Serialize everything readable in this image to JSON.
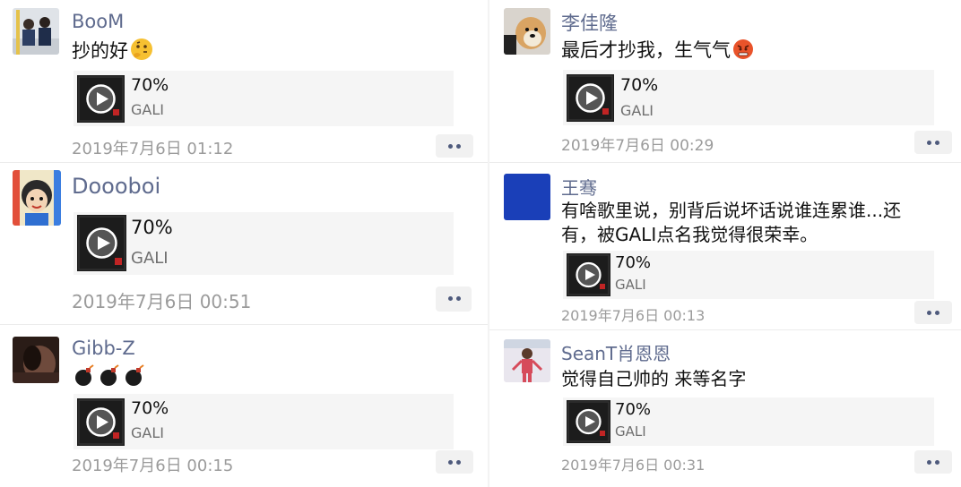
{
  "posts": [
    {
      "username": "BooM",
      "comment": "抄的好",
      "comment_emoji": "thinking-face",
      "music": {
        "title": "70%",
        "artist": "GALI"
      },
      "timestamp": "2019年7月6日 01:12"
    },
    {
      "username": "Doooboi",
      "comment": "",
      "music": {
        "title": "70%",
        "artist": "GALI"
      },
      "timestamp": "2019年7月6日 00:51"
    },
    {
      "username": "Gibb-Z",
      "comment": "",
      "comment_emoji": "bomb x3",
      "music": {
        "title": "70%",
        "artist": "GALI"
      },
      "timestamp": "2019年7月6日 00:15"
    },
    {
      "username": "李佳隆",
      "comment": "最后才抄我，生气气",
      "comment_emoji": "angry-face",
      "music": {
        "title": "70%",
        "artist": "GALI"
      },
      "timestamp": "2019年7月6日 00:29"
    },
    {
      "username": "王骞",
      "comment_line1": "有啥歌里说，别背后说坏话说谁连累谁...还",
      "comment_line2": "有，被GALI点名我觉得很荣幸。",
      "music": {
        "title": "70%",
        "artist": "GALI"
      },
      "timestamp": "2019年7月6日 00:13"
    },
    {
      "username": "SeanT肖恩恩",
      "comment": "觉得自己帅的 来等名字",
      "music": {
        "title": "70%",
        "artist": "GALI"
      },
      "timestamp": "2019年7月6日 00:31"
    }
  ],
  "colors": {
    "username": "#5f6b8e",
    "timestamp": "#9b9b9b",
    "card_bg": "#f5f5f5",
    "more_dots": "#4e5a7c"
  }
}
